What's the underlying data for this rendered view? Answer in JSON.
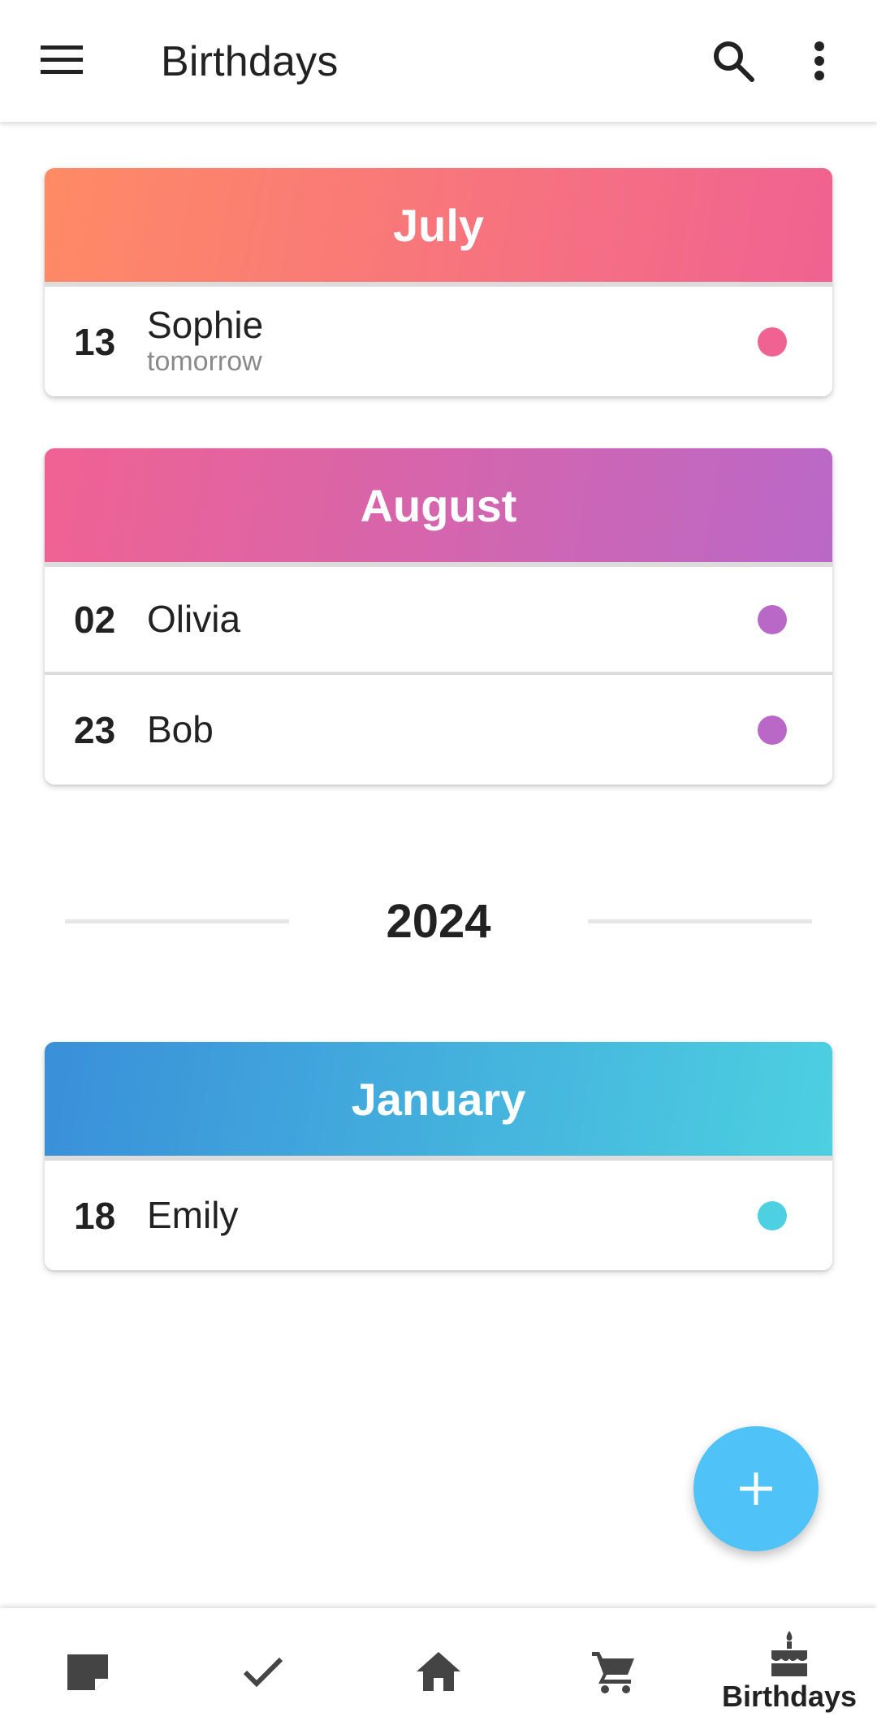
{
  "appbar": {
    "title": "Birthdays",
    "icons": {
      "menu": "menu-icon",
      "search": "search-icon",
      "more": "more-vert-icon"
    }
  },
  "sections": [
    {
      "month": "July",
      "gradient": [
        "#ff8a65",
        "#f06292"
      ],
      "dot_color": "#f06292",
      "entries": [
        {
          "day": "13",
          "name": "Sophie",
          "sub": "tomorrow"
        }
      ]
    },
    {
      "month": "August",
      "gradient": [
        "#f06292",
        "#ba68c8"
      ],
      "dot_color": "#ba68c8",
      "entries": [
        {
          "day": "02",
          "name": "Olivia"
        },
        {
          "day": "23",
          "name": "Bob"
        }
      ]
    }
  ],
  "year_divider": "2024",
  "sections_next": [
    {
      "month": "January",
      "gradient": [
        "#3a8fd9",
        "#4dd0e1"
      ],
      "dot_color": "#4dd0e1",
      "entries": [
        {
          "day": "18",
          "name": "Emily"
        }
      ]
    }
  ],
  "fab": {
    "icon": "plus-icon",
    "color": "#4fc3f7"
  },
  "bottom_nav": {
    "items": [
      {
        "icon": "note-icon"
      },
      {
        "icon": "check-icon"
      },
      {
        "icon": "home-icon"
      },
      {
        "icon": "cart-icon"
      },
      {
        "icon": "cake-icon",
        "label": "Birthdays",
        "active": true
      }
    ]
  }
}
